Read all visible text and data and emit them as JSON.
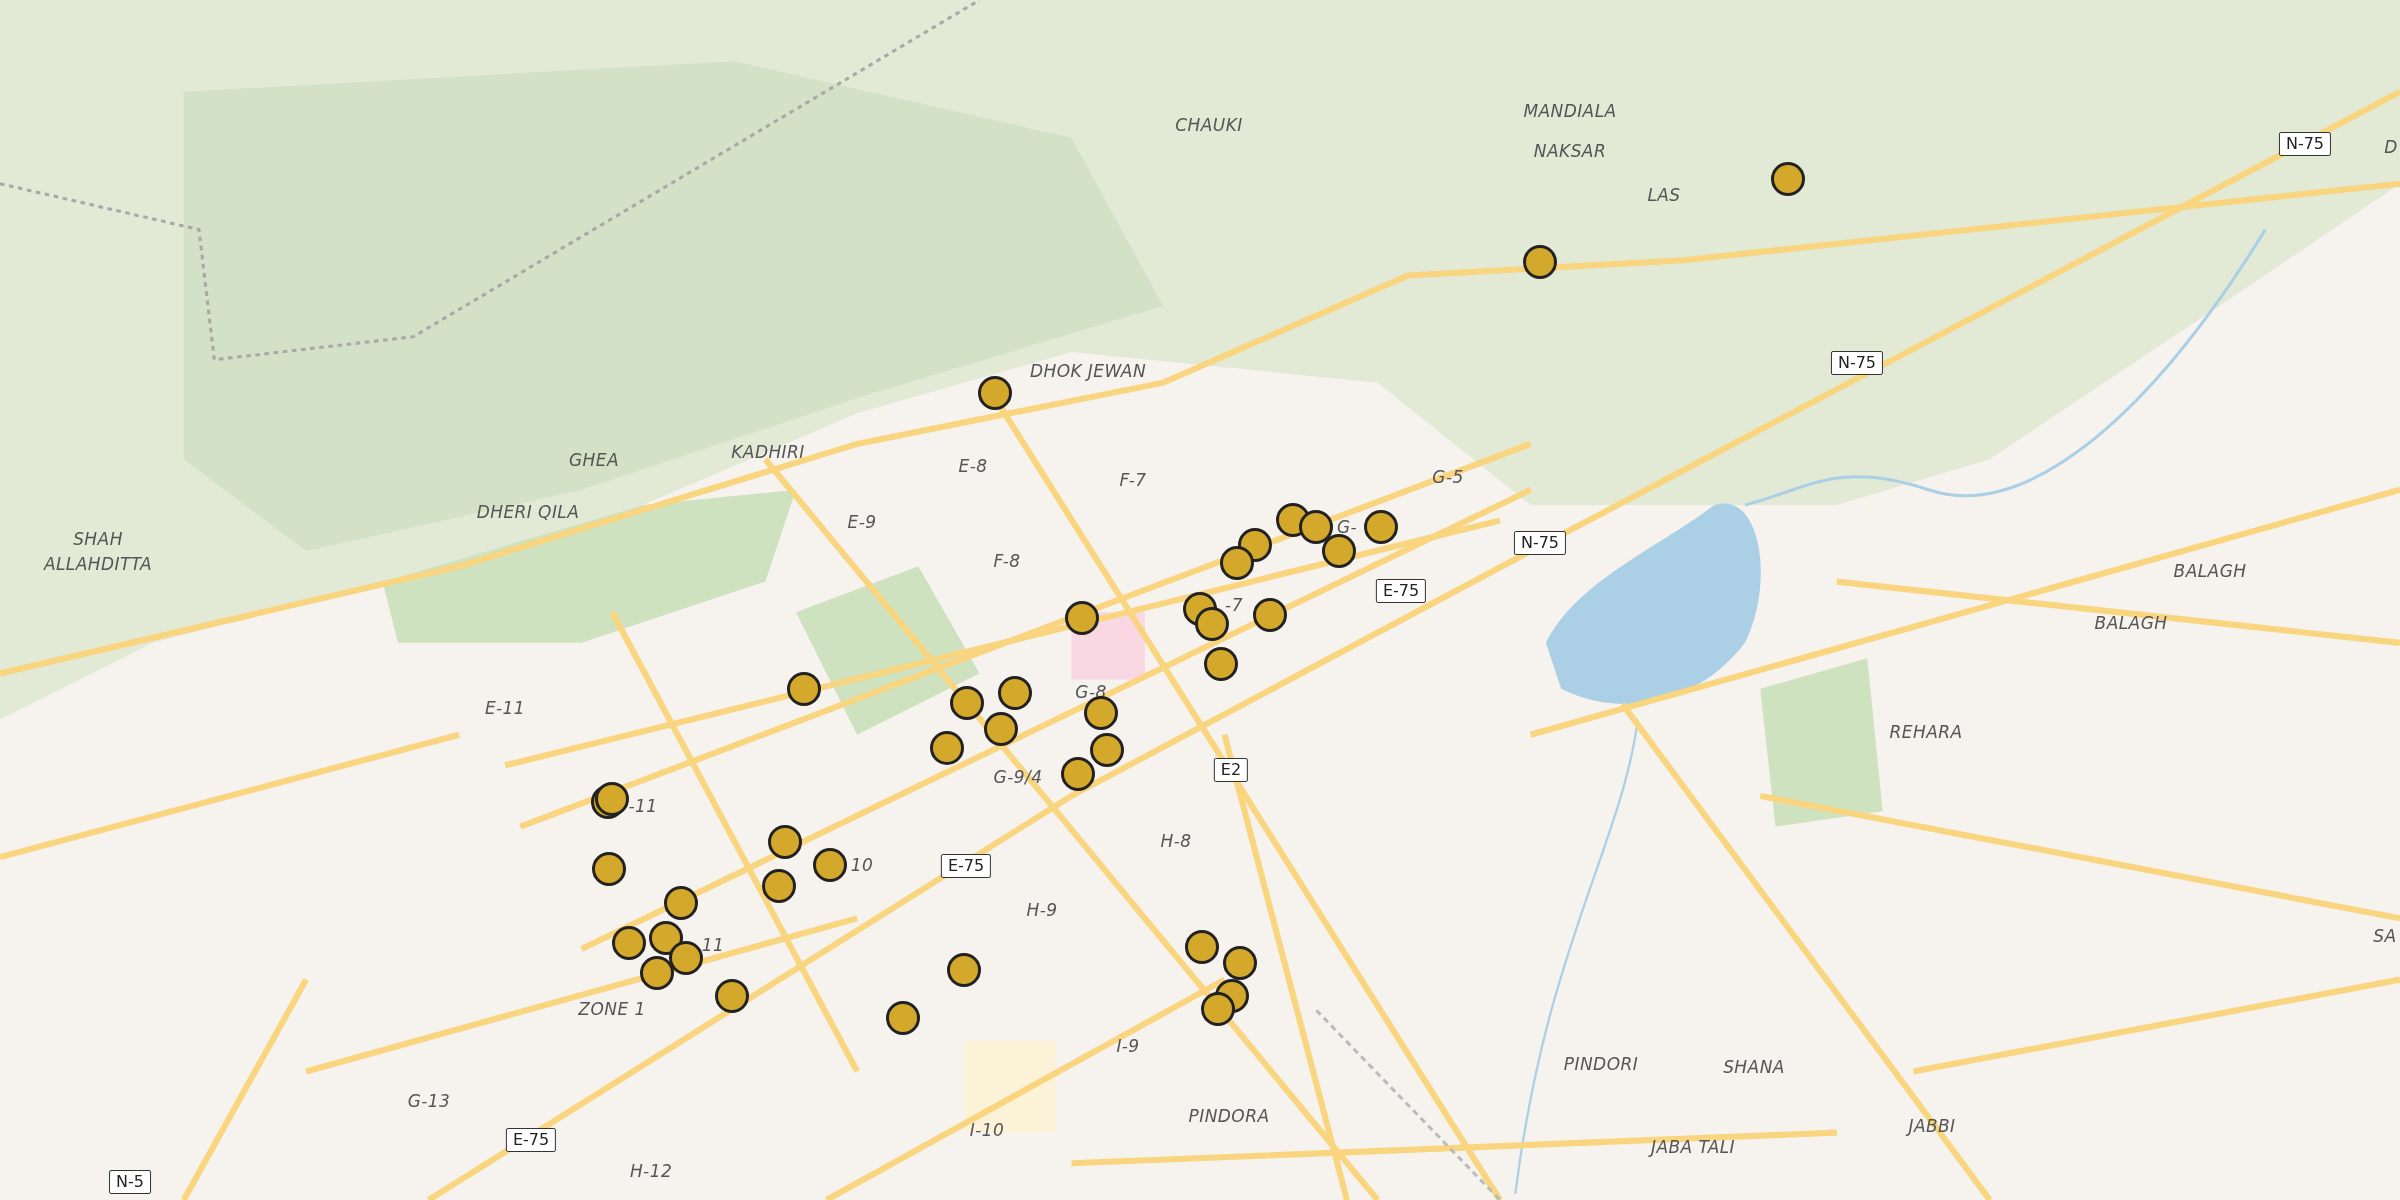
{
  "place_labels": [
    "CHAUKI",
    "MANDIALA",
    "NAKSAR",
    "LAS",
    "D",
    "DHOK JEWAN",
    "GHEA",
    "KADHIRI",
    "DHERI QILA",
    "SHAH",
    "ALLAHDITTA",
    "E-8",
    "F-7",
    "G-5",
    "E-9",
    "F-8",
    "G-",
    "-7",
    "BALAGH",
    "BALAGH",
    "E-11",
    "G-8",
    "REHARA",
    "G-9/4",
    "-11",
    "H-8",
    "10",
    "H-9",
    "11",
    "SA",
    "ZONE 1",
    "I-9",
    "PINDORI",
    "SHANA",
    "G-13",
    "PINDORA",
    "I-10",
    "JABBI",
    "JABA TALI",
    "H-12"
  ],
  "road_shields": [
    "N-75",
    "N-75",
    "N-75",
    "E-75",
    "E2",
    "E-75",
    "E-75",
    "N-5"
  ]
}
